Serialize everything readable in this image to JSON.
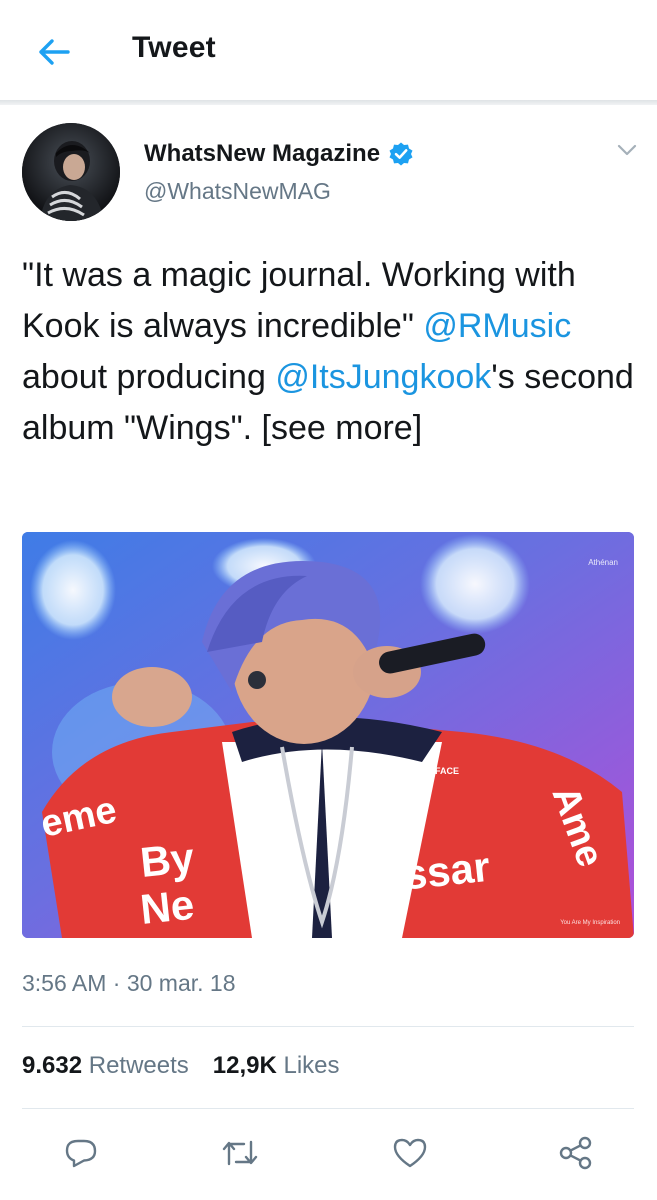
{
  "header": {
    "back_icon": "arrow-left-icon",
    "title": "Tweet"
  },
  "author": {
    "name": "WhatsNew Magazine",
    "handle": "@WhatsNewMAG",
    "verified_icon": "verified-badge-icon",
    "menu_icon": "chevron-down-icon"
  },
  "tweet": {
    "text_part1": "\"It was a magic journal. Working with Kook is always incredible\" ",
    "mention1": "@RMusic",
    "text_part2": " about producing ",
    "mention2": "@ItsJungkook",
    "text_part3": "'s second album \"Wings\". ",
    "see_more": "[see more]"
  },
  "media": {
    "watermark": "Athénan",
    "caption": "You Are My Inspiration"
  },
  "meta": {
    "timestamp": "3:56 AM · 30 mar. 18"
  },
  "stats": {
    "retweets_count": "9.632",
    "retweets_label": "Retweets",
    "likes_count": "12,9K",
    "likes_label": "Likes"
  },
  "actions": {
    "reply_icon": "reply-icon",
    "retweet_icon": "retweet-icon",
    "like_icon": "heart-icon",
    "share_icon": "share-icon"
  },
  "colors": {
    "link": "#1b95e0",
    "muted": "#657786",
    "text": "#14171a",
    "verified": "#1da1f2"
  }
}
